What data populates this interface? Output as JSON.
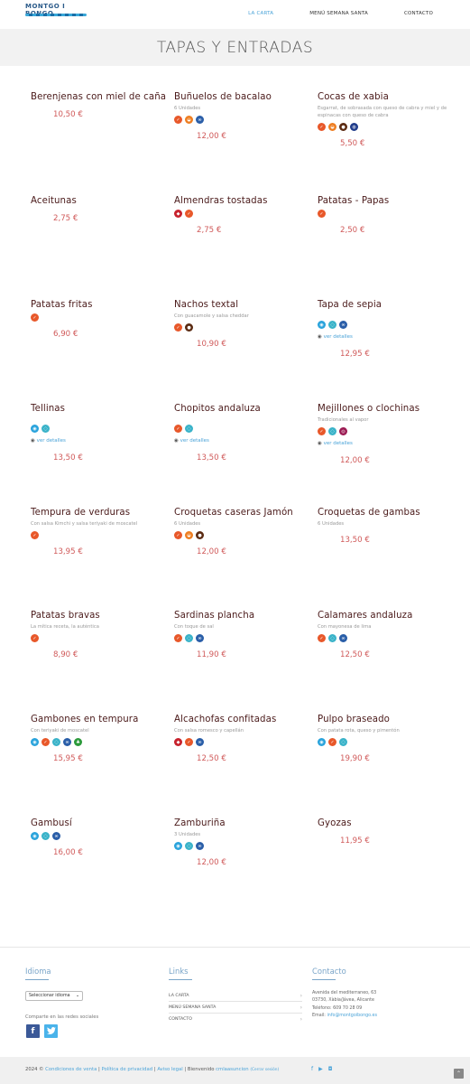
{
  "header": {
    "logo_text": "MONTGO I BONGO",
    "nav": [
      {
        "label": "LA CARTA",
        "active": true
      },
      {
        "label": "MENÚ SEMANA SANTA",
        "active": false
      },
      {
        "label": "CONTACTO",
        "active": false
      }
    ]
  },
  "page_title": "TAPAS Y ENTRADAS",
  "ver_detalles": "ver detalles",
  "items": [
    {
      "name": "Berenjenas con miel de caña",
      "desc": "",
      "icons": [],
      "price": "10,50 €",
      "ver": false
    },
    {
      "name": "Buñuelos de bacalao",
      "desc": "6 Unidades",
      "icons": [
        "gluten-icon",
        "lacteos-icon",
        "pescado-icon"
      ],
      "price": "12,00 €",
      "ver": false
    },
    {
      "name": "Cocas de xabia",
      "desc": "Esgarrat, de sobrasada con queso de cabra y miel y de espinacas con queso de cabra",
      "icons": [
        "gluten-icon",
        "lacteos-icon",
        "huevo-icon",
        "soja-icon"
      ],
      "price": "5,50 €",
      "ver": false
    },
    {
      "name": "Aceitunas",
      "desc": "",
      "icons": [],
      "price": "2,75 €",
      "ver": false
    },
    {
      "name": "Almendras tostadas",
      "desc": "",
      "icons": [
        "frutos-secos-icon",
        "gluten-icon"
      ],
      "price": "2,75 €",
      "ver": false
    },
    {
      "name": "Patatas - Papas",
      "desc": "",
      "icons": [
        "gluten-icon"
      ],
      "price": "2,50 €",
      "ver": false
    },
    {
      "name": "Patatas fritas",
      "desc": "",
      "icons": [
        "gluten-icon"
      ],
      "price": "6,90 €",
      "ver": false
    },
    {
      "name": "Nachos textal",
      "desc": "Con guacamole y salsa cheddar",
      "icons": [
        "gluten-icon",
        "huevo-icon"
      ],
      "price": "10,90 €",
      "ver": false
    },
    {
      "name": "Tapa de sepia",
      "desc": "",
      "icons": [
        "moluscos-icon",
        "crustaceos-icon",
        "pescado-icon"
      ],
      "price": "12,95 €",
      "ver": true
    },
    {
      "name": "Tellinas",
      "desc": "",
      "icons": [
        "moluscos-icon",
        "crustaceos-icon"
      ],
      "price": "13,50 €",
      "ver": true
    },
    {
      "name": "Chopitos andaluza",
      "desc": "",
      "icons": [
        "gluten-icon",
        "crustaceos-icon"
      ],
      "price": "13,50 €",
      "ver": true
    },
    {
      "name": "Mejillones o clochinas",
      "desc": "Tradicionales al vapor",
      "icons": [
        "gluten-icon",
        "crustaceos-icon",
        "sulfitos-icon"
      ],
      "price": "12,00 €",
      "ver": true
    },
    {
      "name": "Tempura de verduras",
      "desc": "Con salsa Kimchi y salsa teriyaki de moscatel",
      "icons": [
        "gluten-icon"
      ],
      "price": "13,95 €",
      "ver": false
    },
    {
      "name": "Croquetas caseras Jamón",
      "desc": "6 Unidades",
      "icons": [
        "gluten-icon",
        "lacteos-icon",
        "huevo-icon"
      ],
      "price": "12,00 €",
      "ver": false
    },
    {
      "name": "Croquetas de gambas",
      "desc": "6 Unidades",
      "icons": [],
      "price": "13,50 €",
      "ver": false
    },
    {
      "name": "Patatas bravas",
      "desc": "La mítica receta, la auténtica",
      "icons": [
        "gluten-icon"
      ],
      "price": "8,90 €",
      "ver": false
    },
    {
      "name": "Sardinas plancha",
      "desc": "Con toque de sal",
      "icons": [
        "gluten-icon",
        "crustaceos-icon",
        "pescado-icon"
      ],
      "price": "11,90 €",
      "ver": false
    },
    {
      "name": "Calamares andaluza",
      "desc": "Con mayonesa de lima",
      "icons": [
        "gluten-icon",
        "crustaceos-icon",
        "pescado-icon"
      ],
      "price": "12,50 €",
      "ver": false
    },
    {
      "name": "Gambones en tempura",
      "desc": "Con teriyaki de moscatel",
      "icons": [
        "moluscos-icon",
        "gluten-icon",
        "crustaceos-icon",
        "pescado-icon",
        "apio-icon"
      ],
      "price": "15,95 €",
      "ver": false
    },
    {
      "name": "Alcachofas confitadas",
      "desc": "Con salsa romesco y capellán",
      "icons": [
        "frutos-secos-icon",
        "gluten-icon",
        "pescado-icon"
      ],
      "price": "12,50 €",
      "ver": false
    },
    {
      "name": "Pulpo braseado",
      "desc": "Con patata rota, queso y pimentón",
      "icons": [
        "moluscos-icon",
        "gluten-icon",
        "crustaceos-icon"
      ],
      "price": "19,90 €",
      "ver": false
    },
    {
      "name": "Gambusí",
      "desc": "",
      "icons": [
        "moluscos-icon",
        "crustaceos-icon",
        "pescado-icon"
      ],
      "price": "16,00 €",
      "ver": false
    },
    {
      "name": "Zamburiña",
      "desc": "3 Unidades",
      "icons": [
        "moluscos-icon",
        "crustaceos-icon",
        "pescado-icon"
      ],
      "price": "12,00 €",
      "ver": false
    },
    {
      "name": "Gyozas",
      "desc": "",
      "icons": [],
      "price": "11,95 €",
      "ver": false
    }
  ],
  "footer": {
    "idioma_title": "Idioma",
    "select_label": "Seleccionar idioma",
    "share_text": "Comparte en las redes sociales",
    "links_title": "Links",
    "links": [
      "LA CARTA",
      "MENÚ SEMANA SANTA",
      "CONTACTO"
    ],
    "contacto_title": "Contacto",
    "address1": "Avenida del mediterraneo, 63",
    "address2": "03730, Xàbia/Jávea, Alicante",
    "phone": "Teléfono: 609 70 28 09",
    "email_label": "Email: ",
    "email": "info@montgoibongo.es"
  },
  "bottom": {
    "copyright": "2024 © ",
    "terms": "Condiciones de venta",
    "sep1": " | ",
    "privacy": "Política de privacidad",
    "sep2": " | ",
    "legal": "Aviso legal",
    "sep3": " | Bienvenido ",
    "user": "cmlaasuncion",
    "logout": "(Cerrar sesión)"
  },
  "icon_colors": {
    "accent_blue": "#4aa3d8",
    "price_red": "#d05a5a",
    "title_dark_red": "#4a1a1a"
  }
}
